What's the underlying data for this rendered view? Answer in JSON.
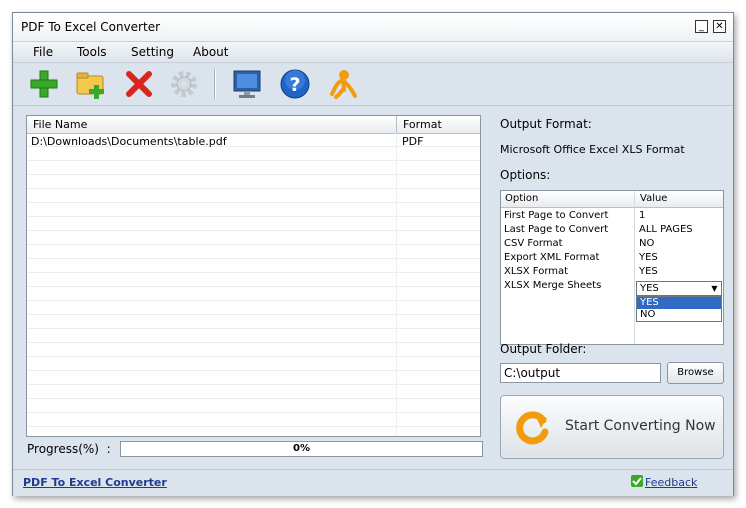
{
  "window": {
    "title": "PDF To Excel Converter",
    "minimize_glyph": "_",
    "close_glyph": "✕"
  },
  "menu": [
    "File",
    "Tools",
    "Setting",
    "About"
  ],
  "toolbar": {
    "icons": [
      "add-icon",
      "add-folder-icon",
      "remove-icon",
      "settings-icon",
      "monitor-icon",
      "help-icon",
      "user-icon"
    ],
    "colors": {
      "green": "#3aa829",
      "red": "#d9261c",
      "blue": "#1f63c9",
      "orange": "#f29b0f"
    }
  },
  "file_list": {
    "columns": [
      "File Name",
      "Format"
    ],
    "rows": [
      {
        "name": "D:\\Downloads\\Documents\\table.pdf",
        "format": "PDF"
      }
    ]
  },
  "progress": {
    "label": "Progress(%)",
    "separator": ":",
    "value_text": "0%",
    "fraction": 0.0
  },
  "output_format": {
    "label": "Output Format:",
    "value": "Microsoft Office Excel XLS Format"
  },
  "options": {
    "label": "Options:",
    "columns": [
      "Option",
      "Value"
    ],
    "rows": [
      {
        "option": "First Page to Convert",
        "value": "1"
      },
      {
        "option": "Last Page to Convert",
        "value": "ALL PAGES"
      },
      {
        "option": "CSV Format",
        "value": "NO"
      },
      {
        "option": "Export XML Format",
        "value": "YES"
      },
      {
        "option": "XLSX Format",
        "value": "YES"
      },
      {
        "option": "XLSX Merge Sheets",
        "value": "YES"
      }
    ],
    "dropdown_arrow": "▼",
    "dropdown_options": [
      "YES",
      "NO"
    ],
    "dropdown_selected": "YES"
  },
  "output_folder": {
    "label": "Output Folder:",
    "value": "C:\\output",
    "browse_label": "Browse"
  },
  "start_button": {
    "label": "Start Converting Now"
  },
  "statusbar": {
    "app_link": "PDF To Excel Converter",
    "feedback": "Feedback"
  }
}
